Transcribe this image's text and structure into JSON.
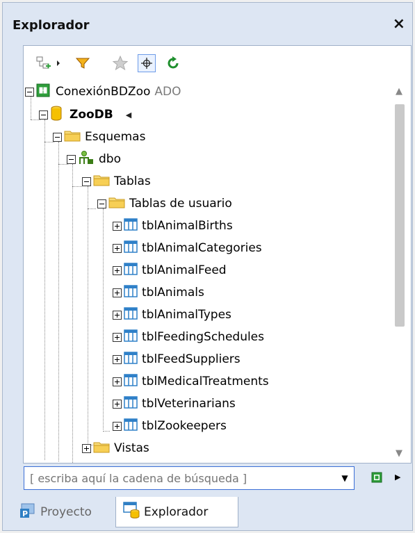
{
  "panel": {
    "title": "Explorador",
    "close_label": "×"
  },
  "toolbar": {
    "icons": [
      "add-connection-icon",
      "dropdown-arrow-icon",
      "filter-icon",
      "favorite-star-icon",
      "locate-icon",
      "refresh-icon"
    ]
  },
  "tree": {
    "connection": {
      "label": "ConexiónBDZoo",
      "type": "ADO"
    },
    "database": {
      "label": "ZooDB"
    },
    "schemas_folder": {
      "label": "Esquemas"
    },
    "schema": {
      "label": "dbo"
    },
    "tables_folder": {
      "label": "Tablas"
    },
    "user_tables_folder": {
      "label": "Tablas de usuario"
    },
    "tables": [
      "tblAnimalBirths",
      "tblAnimalCategories",
      "tblAnimalFeed",
      "tblAnimals",
      "tblAnimalTypes",
      "tblFeedingSchedules",
      "tblFeedSuppliers",
      "tblMedicalTreatments",
      "tblVeterinarians",
      "tblZookeepers"
    ],
    "views_folder": {
      "label": "Vistas"
    }
  },
  "search": {
    "placeholder": "[ escriba aquí la cadena de búsqueda ]"
  },
  "tabs": {
    "project": "Proyecto",
    "explorer": "Explorador",
    "active": "Explorador"
  },
  "colors": {
    "accent": "#3a6ed6",
    "folder": "#f2c94c",
    "table": "#2f80c8",
    "pane_bg": "#dde6f3"
  }
}
